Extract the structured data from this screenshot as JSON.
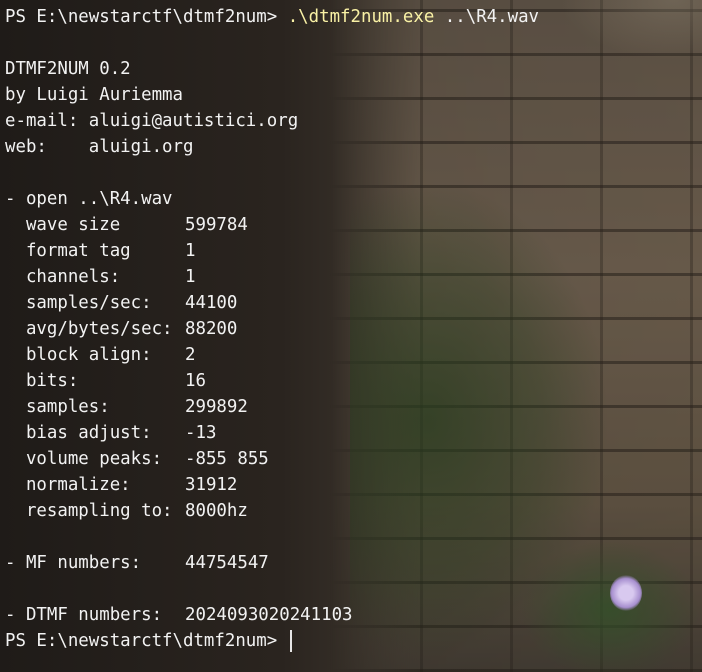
{
  "prompt_text": "PS E:\\newstarctf\\dtmf2num> ",
  "command": {
    "exe": ".\\dtmf2num.exe",
    "arg": "..\\R4.wav"
  },
  "banner": {
    "line1": "DTMF2NUM 0.2",
    "line2": "by Luigi Auriemma",
    "line3": "e-mail: aluigi@autistici.org",
    "line4": "web:    aluigi.org"
  },
  "open_line": "- open ..\\R4.wav",
  "stats": [
    {
      "key": "  wave size",
      "value": "599784"
    },
    {
      "key": "  format tag",
      "value": "1"
    },
    {
      "key": "  channels:",
      "value": "1"
    },
    {
      "key": "  samples/sec:",
      "value": "44100"
    },
    {
      "key": "  avg/bytes/sec:",
      "value": "88200"
    },
    {
      "key": "  block align:",
      "value": "2"
    },
    {
      "key": "  bits:",
      "value": "16"
    },
    {
      "key": "  samples:",
      "value": "299892"
    },
    {
      "key": "  bias adjust:",
      "value": "-13"
    },
    {
      "key": "  volume peaks:",
      "value": "-855 855"
    },
    {
      "key": "  normalize:",
      "value": "31912"
    },
    {
      "key": "  resampling to:",
      "value": "8000hz"
    }
  ],
  "mf": {
    "key": "- MF numbers:",
    "value": "44754547"
  },
  "dtmf": {
    "key": "- DTMF numbers:",
    "value": "2024093020241103"
  },
  "colors": {
    "text": "#f2f2f2",
    "command": "#f9f1a5"
  }
}
